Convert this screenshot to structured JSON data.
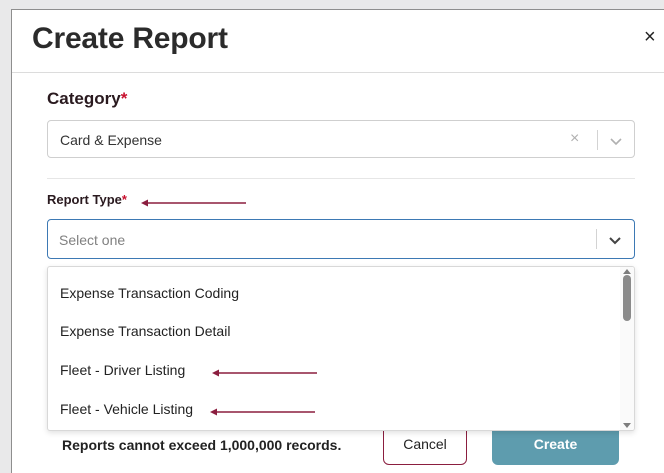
{
  "dialog": {
    "title": "Create Report",
    "close_label": "×"
  },
  "category": {
    "label": "Category",
    "required_mark": "*",
    "value": "Card & Expense",
    "clear_label": "×"
  },
  "report_type": {
    "label": "Report Type",
    "required_mark": "*",
    "placeholder": "Select one",
    "options": [
      "Expense Transaction Coding",
      "Expense Transaction Detail",
      "Fleet - Driver Listing",
      "Fleet - Vehicle Listing"
    ]
  },
  "footer": {
    "note": "Reports cannot exceed 1,000,000 records.",
    "cancel_label": "Cancel",
    "create_label": "Create"
  },
  "icons": {
    "close": "close-icon",
    "clear": "clear-icon",
    "chevron": "chevron-down-icon",
    "annotation_arrow": "arrow-left-icon"
  },
  "colors": {
    "accent_maroon": "#8b1e3f",
    "required_red": "#c8102e",
    "focus_blue": "#3d79b4",
    "create_button": "#5e9cae"
  }
}
